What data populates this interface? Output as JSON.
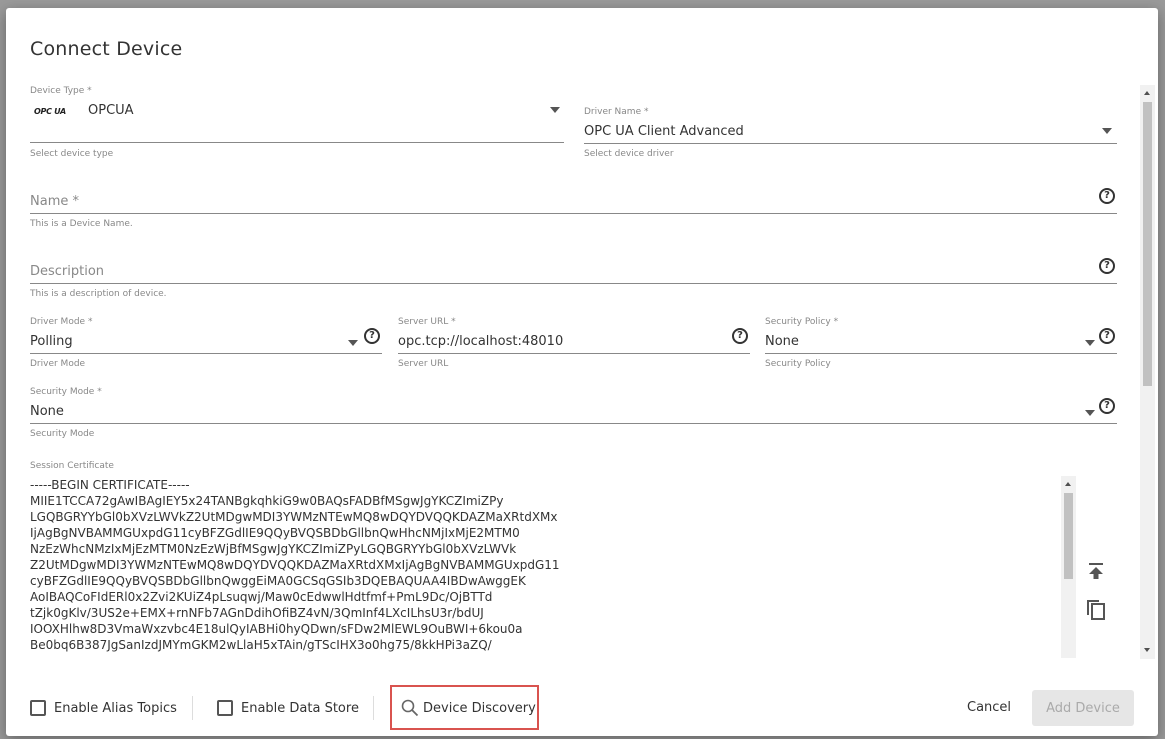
{
  "dialog": {
    "title": "Connect Device"
  },
  "device_type": {
    "label": "Device Type *",
    "logo_text": "OPC UA",
    "value": "OPCUA",
    "hint": "Select device type"
  },
  "driver_name": {
    "label": "Driver Name *",
    "value": "OPC UA Client Advanced",
    "hint": "Select device driver"
  },
  "name_field": {
    "placeholder": "Name *",
    "hint": "This is a Device Name."
  },
  "description_field": {
    "placeholder": "Description",
    "hint": "This is a description of device."
  },
  "driver_mode": {
    "label": "Driver Mode *",
    "value": "Polling",
    "hint": "Driver Mode"
  },
  "server_url": {
    "label": "Server URL *",
    "value": "opc.tcp://localhost:48010",
    "hint": "Server URL"
  },
  "security_policy": {
    "label": "Security Policy *",
    "value": "None",
    "hint": "Security Policy"
  },
  "security_mode": {
    "label": "Security Mode *",
    "value": "None",
    "hint": "Security Mode"
  },
  "session_certificate": {
    "label": "Session Certificate",
    "lines": [
      "-----BEGIN CERTIFICATE-----",
      "MIIE1TCCA72gAwIBAgIEY5x24TANBgkqhkiG9w0BAQsFADBfMSgwJgYKCZImiZPy",
      "LGQBGRYYbGl0bXVzLWVkZ2UtMDgwMDI3YWMzNTEwMQ8wDQYDVQQKDAZMaXRtdXMx",
      "IjAgBgNVBAMMGUxpdG11cyBFZGdlIE9QQyBVQSBDbGllbnQwHhcNMjIxMjE2MTM0",
      "NzEzWhcNMzIxMjEzMTM0NzEzWjBfMSgwJgYKCZImiZPyLGQBGRYYbGl0bXVzLWVk",
      "Z2UtMDgwMDI3YWMzNTEwMQ8wDQYDVQQKDAZMaXRtdXMxIjAgBgNVBAMMGUxpdG11",
      "cyBFZGdlIE9QQyBVQSBDbGllbnQwggEiMA0GCSqGSIb3DQEBAQUAA4IBDwAwggEK",
      "AoIBAQCoFIdERl0x2Zvi2KUiZ4pLsuqwj/Maw0cEdwwlHdtfmf+PmL9Dc/OjBTTd",
      "tZjk0gKlv/3US2e+EMX+rnNFb7AGnDdihOfiBZ4vN/3QmInf4LXcILhsU3r/bdUJ",
      "IOOXHlhw8D3VmaWxzvbc4E18ulQyIABHi0hyQDwn/sFDw2MlEWL9OuBWI+6kou0a",
      "Be0bq6B387JgSanIzdJMYmGKM2wLlaH5xTAin/gTScIHX3o0hg75/8kkHPi3aZQ/"
    ]
  },
  "icons": {
    "upload": "upload-icon",
    "copy": "copy-icon",
    "search": "search-icon",
    "help": "help-icon"
  },
  "footer": {
    "enable_alias_topics": "Enable Alias Topics",
    "enable_data_store": "Enable Data Store",
    "device_discovery": "Device Discovery",
    "cancel": "Cancel",
    "add_device": "Add Device"
  },
  "colors": {
    "highlight_border": "#d9534f",
    "disabled_button_bg": "#e6e6e6",
    "disabled_button_text": "#aaa"
  }
}
